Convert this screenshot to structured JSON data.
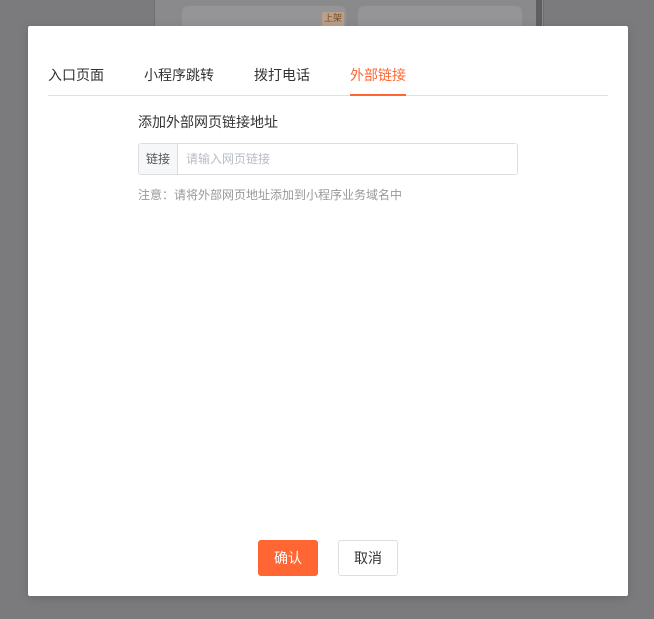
{
  "background": {
    "tag_label": "上架"
  },
  "modal": {
    "tabs": [
      {
        "label": "入口页面"
      },
      {
        "label": "小程序跳转"
      },
      {
        "label": "拨打电话"
      },
      {
        "label": "外部链接",
        "active": true
      }
    ],
    "section_title": "添加外部网页链接地址",
    "link_field": {
      "addon_label": "链接",
      "placeholder": "请输入网页链接",
      "value": ""
    },
    "note": "注意：请将外部网页地址添加到小程序业务域名中",
    "buttons": {
      "confirm": "确认",
      "cancel": "取消"
    }
  },
  "colors": {
    "accent": "#ff6633",
    "overlay": "#7b7b7d",
    "muted_text": "#999999"
  }
}
